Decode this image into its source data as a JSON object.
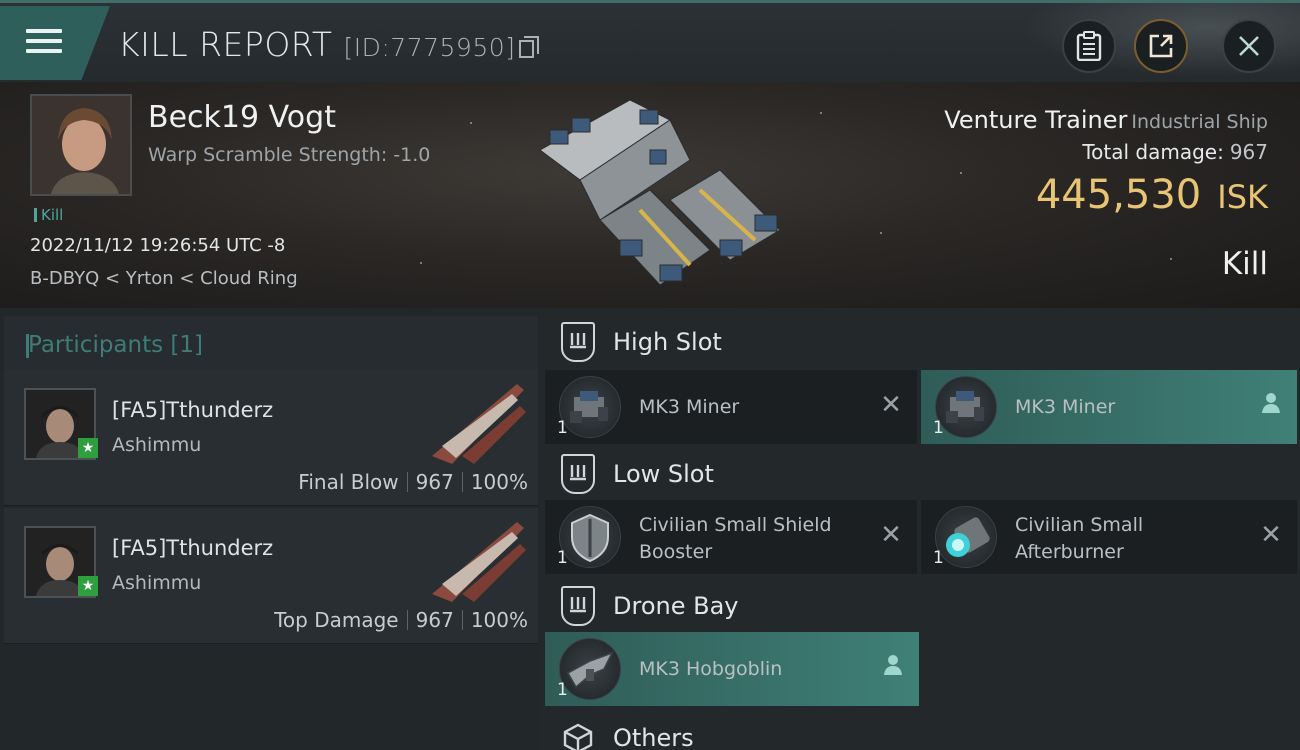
{
  "header": {
    "title": "KILL REPORT",
    "report_id": "[ID:7775950]",
    "icons": {
      "menu": "hamburger-menu-icon",
      "copy": "copy-icon",
      "report": "clipboard-icon",
      "share": "share-icon",
      "close": "close-icon"
    }
  },
  "victim": {
    "name": "Beck19 Vogt",
    "warp_scramble": "Warp Scramble Strength: -1.0",
    "kill_tag": "Kill",
    "time": "2022/11/12 19:26:54 UTC -8",
    "location": "B-DBYQ < Yrton < Cloud Ring"
  },
  "ship": {
    "name": "Venture Trainer",
    "class": "Industrial Ship",
    "total_damage_label": "Total damage:",
    "total_damage": "967",
    "isk_value": "445,530",
    "isk_unit": "ISK",
    "result": "Kill"
  },
  "participants": {
    "title": "Participants [1]",
    "items": [
      {
        "name": "[FA5]Tthunderz",
        "corp": "Ashimmu",
        "role": "Final Blow",
        "damage": "967",
        "percent": "100%"
      },
      {
        "name": "[FA5]Tthunderz",
        "corp": "Ashimmu",
        "role": "Top Damage",
        "damage": "967",
        "percent": "100%"
      }
    ]
  },
  "fitting": {
    "high_slot": {
      "label": "High Slot",
      "modules": [
        {
          "qty": "1",
          "name": "MK3 Miner",
          "status": "destroyed"
        },
        {
          "qty": "1",
          "name": "MK3 Miner",
          "status": "dropped"
        }
      ]
    },
    "low_slot": {
      "label": "Low Slot",
      "modules": [
        {
          "qty": "1",
          "name_line1": "Civilian Small Shield",
          "name_line2": "Booster",
          "status": "destroyed"
        },
        {
          "qty": "1",
          "name_line1": "Civilian Small",
          "name_line2": "Afterburner",
          "status": "destroyed"
        }
      ]
    },
    "drone_bay": {
      "label": "Drone Bay",
      "modules": [
        {
          "qty": "1",
          "name": "MK3  Hobgoblin",
          "status": "dropped"
        }
      ]
    },
    "others": {
      "label": "Others"
    }
  },
  "colors": {
    "accent": "#3f7c77",
    "isk": "#e8c474",
    "header_tab": "#2f5f5a",
    "dropped_item": "#3f8077"
  }
}
